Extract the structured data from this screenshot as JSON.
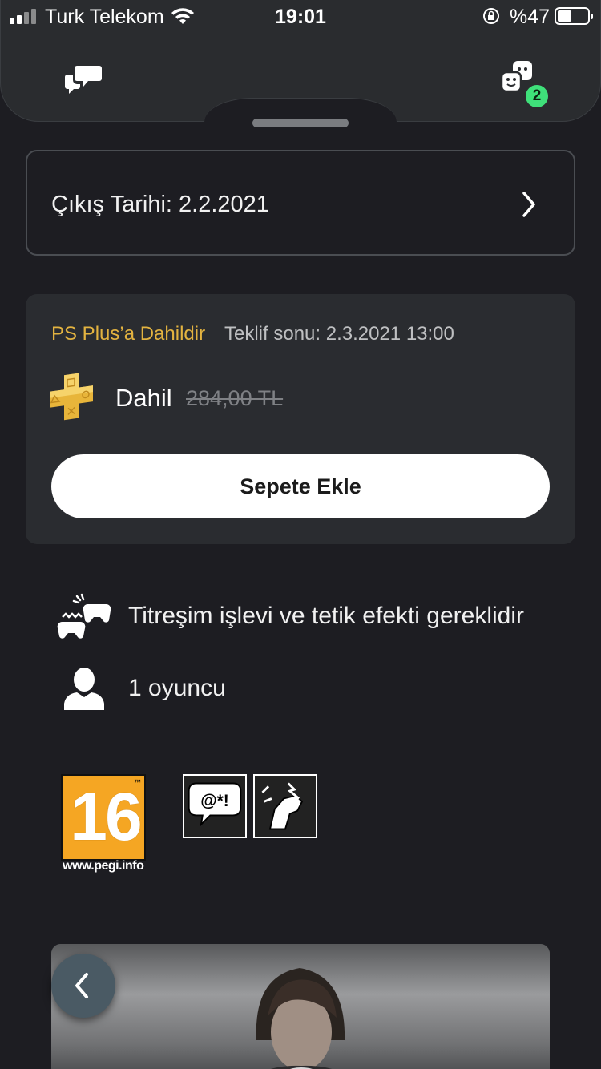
{
  "status_bar": {
    "carrier": "Turk Telekom",
    "time": "19:01",
    "battery_percent": "%47",
    "battery_level": 0.47
  },
  "header": {
    "friends_badge": "2"
  },
  "release": {
    "label": "Çıkış Tarihi: 2.2.2021"
  },
  "offer": {
    "plus_label": "PS Plus’a Dahildir",
    "offer_end": "Teklif sonu: 2.3.2021  13:00",
    "price_included": "Dahil",
    "price_original": "284,00 TL",
    "add_to_cart": "Sepete Ekle"
  },
  "features": [
    {
      "icon": "controller-vibration-icon",
      "text": "Titreşim işlevi ve tetik efekti gereklidir"
    },
    {
      "icon": "person-icon",
      "text": "1 oyuncu"
    }
  ],
  "rating": {
    "pegi_age": "16",
    "pegi_url": "www.pegi.info",
    "descriptors": [
      "bad-language-icon",
      "violence-icon"
    ]
  },
  "colors": {
    "background": "#1d1d22",
    "card": "#2a2c30",
    "plus_gold": "#e3b340",
    "badge_green": "#3fe07a",
    "pegi_orange": "#f5a623"
  }
}
